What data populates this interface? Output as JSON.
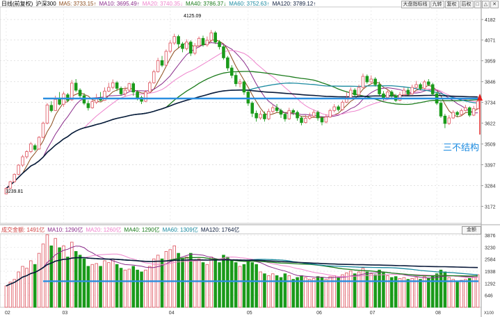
{
  "legend": {
    "symbol_label": "日线(前复权)",
    "index_name": "沪深300",
    "ma5": "MA5: 3733.15↑",
    "ma10": "MA10: 3695.49↑",
    "ma20": "MA20: 3740.35↓",
    "ma40": "MA40: 3786.37↓",
    "ma60": "MA60: 3752.63↑",
    "ma120": "MA120: 3789.12↑"
  },
  "vol_legend": {
    "volume": "成交金额: 1491亿",
    "ma10": "MA10: 1290亿",
    "ma20": "MA20: 1260亿",
    "ma40": "MA40: 1290亿",
    "ma60": "MA60: 1309亿",
    "ma120": "MA120: 1764亿"
  },
  "toolbar": [
    "大盘指标线",
    "九转",
    "复权",
    "后权",
    "□",
    "△",
    "✕"
  ],
  "vol_selector": "金额",
  "annotation": "三不结构",
  "high_label": "4125.09",
  "low_label": "3239.81",
  "colors": {
    "up": "#e0606a",
    "down": "#1a9a1a",
    "ma5": "#8b4a1a",
    "ma10": "#8a2a8a",
    "ma20": "#ee82cc",
    "ma40": "#1a7a1a",
    "ma60": "#1a8aa0",
    "ma120": "#0a1a3a",
    "line": "#2a8ee0",
    "arrow": "#e02020",
    "annotation": "#1a8ae0"
  },
  "chart_data": {
    "type": "candlestick",
    "price_axis": {
      "ticks": [
        "4182",
        "4071",
        "3959",
        "3846",
        "3734",
        "3622",
        "3509",
        "3397",
        "3284",
        "3172"
      ],
      "ylim": [
        3080,
        4250
      ]
    },
    "volume_axis": {
      "ticks": [
        "3876",
        "3230",
        "2584",
        "1938",
        "1292",
        "646"
      ],
      "unit": "X100",
      "ylim": [
        0,
        3950
      ]
    },
    "x_labels": [
      "02",
      "03",
      "04",
      "05",
      "06",
      "07",
      "08"
    ],
    "horizontal_lines": [
      {
        "name": "price-support",
        "price": 3755
      },
      {
        "name": "volume-level",
        "volume": 1400
      }
    ],
    "candles": [
      {
        "t": "02",
        "o": 3239,
        "c": 3269,
        "h": 3275,
        "l": 3238,
        "v": 1150
      },
      {
        "o": 3270,
        "c": 3305,
        "h": 3310,
        "l": 3266,
        "v": 1350
      },
      {
        "o": 3305,
        "c": 3345,
        "h": 3350,
        "l": 3300,
        "v": 1500
      },
      {
        "o": 3345,
        "c": 3395,
        "h": 3400,
        "l": 3340,
        "v": 1900
      },
      {
        "o": 3395,
        "c": 3440,
        "h": 3450,
        "l": 3385,
        "v": 2200
      },
      {
        "o": 3440,
        "c": 3468,
        "h": 3475,
        "l": 3430,
        "v": 2100
      },
      {
        "o": 3468,
        "c": 3510,
        "h": 3520,
        "l": 3460,
        "v": 2500
      },
      {
        "o": 3500,
        "c": 3480,
        "h": 3510,
        "l": 3470,
        "v": 2300
      },
      {
        "o": 3482,
        "c": 3545,
        "h": 3552,
        "l": 3478,
        "v": 2900
      },
      {
        "o": 3545,
        "c": 3622,
        "h": 3630,
        "l": 3540,
        "v": 3400
      },
      {
        "o": 3622,
        "c": 3720,
        "h": 3730,
        "l": 3615,
        "v": 3900
      },
      {
        "o": 3718,
        "c": 3690,
        "h": 3740,
        "l": 3680,
        "v": 3300
      },
      {
        "o": 3690,
        "c": 3750,
        "h": 3770,
        "l": 3688,
        "v": 3700
      },
      {
        "o": 3750,
        "c": 3724,
        "h": 3790,
        "l": 3718,
        "v": 3200
      },
      {
        "t": "03",
        "o": 3724,
        "c": 3780,
        "h": 3792,
        "l": 3710,
        "v": 3300
      },
      {
        "o": 3775,
        "c": 3745,
        "h": 3785,
        "l": 3735,
        "v": 2700
      },
      {
        "o": 3748,
        "c": 3838,
        "h": 3855,
        "l": 3742,
        "v": 3500
      },
      {
        "o": 3838,
        "c": 3800,
        "h": 3860,
        "l": 3790,
        "v": 3000
      },
      {
        "o": 3800,
        "c": 3770,
        "h": 3810,
        "l": 3755,
        "v": 2800
      },
      {
        "o": 3770,
        "c": 3730,
        "h": 3785,
        "l": 3720,
        "v": 2600
      },
      {
        "o": 3728,
        "c": 3705,
        "h": 3745,
        "l": 3690,
        "v": 2200
      },
      {
        "o": 3705,
        "c": 3738,
        "h": 3750,
        "l": 3700,
        "v": 2300
      },
      {
        "o": 3735,
        "c": 3760,
        "h": 3780,
        "l": 3725,
        "v": 2350
      },
      {
        "o": 3758,
        "c": 3746,
        "h": 3790,
        "l": 3740,
        "v": 2200
      },
      {
        "o": 3745,
        "c": 3795,
        "h": 3815,
        "l": 3742,
        "v": 2500
      },
      {
        "o": 3795,
        "c": 3815,
        "h": 3840,
        "l": 3790,
        "v": 2400
      },
      {
        "o": 3815,
        "c": 3840,
        "h": 3858,
        "l": 3805,
        "v": 2600
      },
      {
        "o": 3840,
        "c": 3810,
        "h": 3850,
        "l": 3795,
        "v": 2300
      },
      {
        "o": 3810,
        "c": 3780,
        "h": 3820,
        "l": 3770,
        "v": 2100
      },
      {
        "o": 3780,
        "c": 3800,
        "h": 3820,
        "l": 3765,
        "v": 2000
      },
      {
        "o": 3800,
        "c": 3835,
        "h": 3840,
        "l": 3790,
        "v": 2050
      },
      {
        "o": 3835,
        "c": 3790,
        "h": 3845,
        "l": 3770,
        "v": 2200
      },
      {
        "o": 3790,
        "c": 3760,
        "h": 3800,
        "l": 3745,
        "v": 2000
      },
      {
        "o": 3760,
        "c": 3740,
        "h": 3770,
        "l": 3725,
        "v": 1900
      },
      {
        "o": 3740,
        "c": 3790,
        "h": 3800,
        "l": 3735,
        "v": 2000
      },
      {
        "o": 3790,
        "c": 3840,
        "h": 3850,
        "l": 3785,
        "v": 2200
      },
      {
        "o": 3840,
        "c": 3900,
        "h": 3910,
        "l": 3835,
        "v": 2600
      },
      {
        "o": 3900,
        "c": 3960,
        "h": 3975,
        "l": 3895,
        "v": 2800
      },
      {
        "o": 3960,
        "c": 3935,
        "h": 3985,
        "l": 3925,
        "v": 2600
      },
      {
        "o": 3935,
        "c": 4010,
        "h": 4020,
        "l": 3930,
        "v": 3000
      },
      {
        "t": "04",
        "o": 4010,
        "c": 4055,
        "h": 4070,
        "l": 4000,
        "v": 3100
      },
      {
        "o": 4055,
        "c": 4090,
        "h": 4105,
        "l": 4045,
        "v": 3300
      },
      {
        "o": 4090,
        "c": 4050,
        "h": 4100,
        "l": 4030,
        "v": 2900
      },
      {
        "o": 4050,
        "c": 4025,
        "h": 4060,
        "l": 4005,
        "v": 2600
      },
      {
        "o": 4025,
        "c": 4060,
        "h": 4075,
        "l": 4015,
        "v": 2700
      },
      {
        "o": 4060,
        "c": 4000,
        "h": 4070,
        "l": 3985,
        "v": 2900
      },
      {
        "o": 4000,
        "c": 4040,
        "h": 4055,
        "l": 3990,
        "v": 2500
      },
      {
        "o": 4040,
        "c": 4080,
        "h": 4090,
        "l": 4030,
        "v": 2600
      },
      {
        "o": 4080,
        "c": 4045,
        "h": 4095,
        "l": 4035,
        "v": 2400
      },
      {
        "o": 4045,
        "c": 4070,
        "h": 4090,
        "l": 4035,
        "v": 2300
      },
      {
        "o": 4070,
        "c": 4110,
        "h": 4125,
        "l": 4060,
        "v": 2700
      },
      {
        "o": 4110,
        "c": 4060,
        "h": 4120,
        "l": 4050,
        "v": 2600
      },
      {
        "o": 4060,
        "c": 4035,
        "h": 4070,
        "l": 4020,
        "v": 2400
      },
      {
        "o": 4035,
        "c": 3975,
        "h": 4045,
        "l": 3965,
        "v": 2800
      },
      {
        "o": 3975,
        "c": 3920,
        "h": 3985,
        "l": 3905,
        "v": 2700
      },
      {
        "o": 3920,
        "c": 3880,
        "h": 3935,
        "l": 3865,
        "v": 2500
      },
      {
        "o": 3880,
        "c": 3835,
        "h": 3895,
        "l": 3820,
        "v": 2400
      },
      {
        "o": 3835,
        "c": 3845,
        "h": 3860,
        "l": 3815,
        "v": 2200
      },
      {
        "o": 3845,
        "c": 3790,
        "h": 3855,
        "l": 3775,
        "v": 2300
      },
      {
        "t": "05",
        "o": 3790,
        "c": 3730,
        "h": 3800,
        "l": 3715,
        "v": 2500
      },
      {
        "o": 3730,
        "c": 3675,
        "h": 3740,
        "l": 3655,
        "v": 2400
      },
      {
        "o": 3675,
        "c": 3650,
        "h": 3690,
        "l": 3630,
        "v": 2300
      },
      {
        "o": 3650,
        "c": 3670,
        "h": 3690,
        "l": 3640,
        "v": 1900
      },
      {
        "o": 3670,
        "c": 3645,
        "h": 3685,
        "l": 3630,
        "v": 1800
      },
      {
        "o": 3645,
        "c": 3685,
        "h": 3700,
        "l": 3638,
        "v": 1700
      },
      {
        "o": 3685,
        "c": 3705,
        "h": 3720,
        "l": 3675,
        "v": 1800
      },
      {
        "o": 3705,
        "c": 3690,
        "h": 3725,
        "l": 3680,
        "v": 1700
      },
      {
        "o": 3690,
        "c": 3670,
        "h": 3700,
        "l": 3650,
        "v": 1600
      },
      {
        "o": 3670,
        "c": 3645,
        "h": 3680,
        "l": 3630,
        "v": 1800
      },
      {
        "o": 3645,
        "c": 3690,
        "h": 3705,
        "l": 3640,
        "v": 1700
      },
      {
        "o": 3690,
        "c": 3680,
        "h": 3700,
        "l": 3665,
        "v": 1500
      },
      {
        "o": 3680,
        "c": 3650,
        "h": 3690,
        "l": 3635,
        "v": 1600
      },
      {
        "o": 3650,
        "c": 3625,
        "h": 3660,
        "l": 3610,
        "v": 1700
      },
      {
        "o": 3625,
        "c": 3648,
        "h": 3665,
        "l": 3620,
        "v": 1600
      },
      {
        "o": 3648,
        "c": 3660,
        "h": 3678,
        "l": 3640,
        "v": 1500
      },
      {
        "o": 3660,
        "c": 3680,
        "h": 3695,
        "l": 3650,
        "v": 1550
      },
      {
        "t": "06",
        "o": 3680,
        "c": 3650,
        "h": 3690,
        "l": 3635,
        "v": 1650
      },
      {
        "o": 3650,
        "c": 3628,
        "h": 3660,
        "l": 3610,
        "v": 1600
      },
      {
        "o": 3628,
        "c": 3655,
        "h": 3670,
        "l": 3620,
        "v": 1500
      },
      {
        "o": 3655,
        "c": 3690,
        "h": 3700,
        "l": 3650,
        "v": 1650
      },
      {
        "o": 3690,
        "c": 3710,
        "h": 3725,
        "l": 3680,
        "v": 1700
      },
      {
        "o": 3710,
        "c": 3695,
        "h": 3720,
        "l": 3685,
        "v": 1600
      },
      {
        "o": 3695,
        "c": 3735,
        "h": 3745,
        "l": 3690,
        "v": 1750
      },
      {
        "o": 3735,
        "c": 3760,
        "h": 3790,
        "l": 3730,
        "v": 1850
      },
      {
        "o": 3760,
        "c": 3800,
        "h": 3815,
        "l": 3755,
        "v": 1950
      },
      {
        "o": 3800,
        "c": 3775,
        "h": 3810,
        "l": 3765,
        "v": 1800
      },
      {
        "o": 3775,
        "c": 3815,
        "h": 3830,
        "l": 3770,
        "v": 1900
      },
      {
        "o": 3815,
        "c": 3875,
        "h": 3890,
        "l": 3810,
        "v": 2100
      },
      {
        "o": 3875,
        "c": 3845,
        "h": 3885,
        "l": 3835,
        "v": 1900
      },
      {
        "t": "07",
        "o": 3845,
        "c": 3860,
        "h": 3880,
        "l": 3838,
        "v": 1800
      },
      {
        "o": 3860,
        "c": 3830,
        "h": 3870,
        "l": 3820,
        "v": 1750
      },
      {
        "o": 3830,
        "c": 3780,
        "h": 3845,
        "l": 3770,
        "v": 2000
      },
      {
        "o": 3780,
        "c": 3760,
        "h": 3795,
        "l": 3745,
        "v": 1850
      },
      {
        "o": 3760,
        "c": 3790,
        "h": 3805,
        "l": 3750,
        "v": 1700
      },
      {
        "o": 3790,
        "c": 3770,
        "h": 3800,
        "l": 3760,
        "v": 1600
      },
      {
        "o": 3770,
        "c": 3745,
        "h": 3780,
        "l": 3735,
        "v": 1650
      },
      {
        "o": 3745,
        "c": 3775,
        "h": 3790,
        "l": 3740,
        "v": 1550
      },
      {
        "o": 3775,
        "c": 3800,
        "h": 3815,
        "l": 3768,
        "v": 1600
      },
      {
        "o": 3800,
        "c": 3780,
        "h": 3815,
        "l": 3772,
        "v": 1500
      },
      {
        "o": 3780,
        "c": 3815,
        "h": 3830,
        "l": 3775,
        "v": 1550
      },
      {
        "o": 3815,
        "c": 3830,
        "h": 3850,
        "l": 3805,
        "v": 1600
      },
      {
        "o": 3830,
        "c": 3810,
        "h": 3840,
        "l": 3800,
        "v": 1500
      },
      {
        "o": 3810,
        "c": 3845,
        "h": 3855,
        "l": 3805,
        "v": 1650
      },
      {
        "o": 3845,
        "c": 3830,
        "h": 3860,
        "l": 3822,
        "v": 1550
      },
      {
        "o": 3830,
        "c": 3780,
        "h": 3840,
        "l": 3770,
        "v": 1700
      },
      {
        "t": "08",
        "o": 3780,
        "c": 3730,
        "h": 3790,
        "l": 3720,
        "v": 1800
      },
      {
        "o": 3730,
        "c": 3660,
        "h": 3740,
        "l": 3650,
        "v": 2000
      },
      {
        "o": 3660,
        "c": 3620,
        "h": 3672,
        "l": 3595,
        "v": 1900
      },
      {
        "o": 3620,
        "c": 3650,
        "h": 3665,
        "l": 3612,
        "v": 1600
      },
      {
        "o": 3650,
        "c": 3680,
        "h": 3692,
        "l": 3645,
        "v": 1500
      },
      {
        "o": 3680,
        "c": 3668,
        "h": 3688,
        "l": 3655,
        "v": 1400
      },
      {
        "o": 3668,
        "c": 3690,
        "h": 3700,
        "l": 3660,
        "v": 1450
      },
      {
        "o": 3690,
        "c": 3705,
        "h": 3720,
        "l": 3685,
        "v": 1500
      },
      {
        "o": 3705,
        "c": 3665,
        "h": 3712,
        "l": 3655,
        "v": 1550
      },
      {
        "o": 3665,
        "c": 3700,
        "h": 3715,
        "l": 3660,
        "v": 1600
      },
      {
        "o": 3700,
        "c": 3740,
        "h": 3765,
        "l": 3695,
        "v": 1750
      }
    ]
  }
}
